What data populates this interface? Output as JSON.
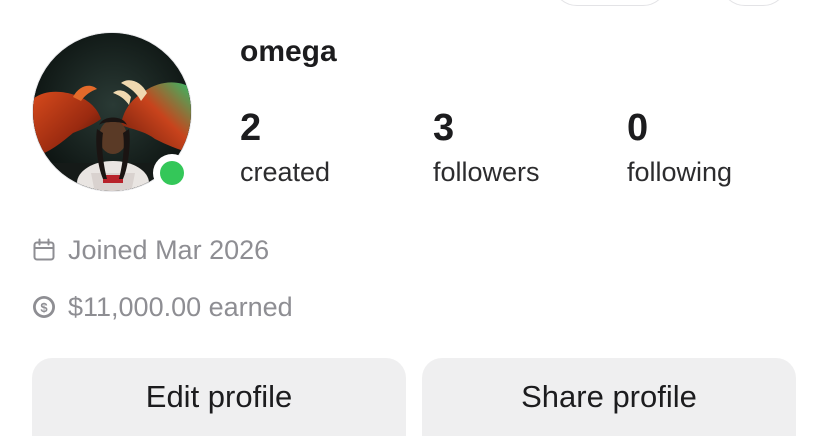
{
  "profile": {
    "username": "omega",
    "online": true,
    "avatar_icon": "profile-photo",
    "status_color": "#34c759"
  },
  "stats": {
    "created": {
      "value": "2",
      "label": "created"
    },
    "followers": {
      "value": "3",
      "label": "followers"
    },
    "following": {
      "value": "0",
      "label": "following"
    }
  },
  "meta": {
    "joined": {
      "icon": "calendar-icon",
      "text": "Joined Mar 2026"
    },
    "earned": {
      "icon": "dollar-circle-icon",
      "text": "$11,000.00 earned"
    }
  },
  "actions": {
    "edit_label": "Edit profile",
    "share_label": "Share profile"
  }
}
